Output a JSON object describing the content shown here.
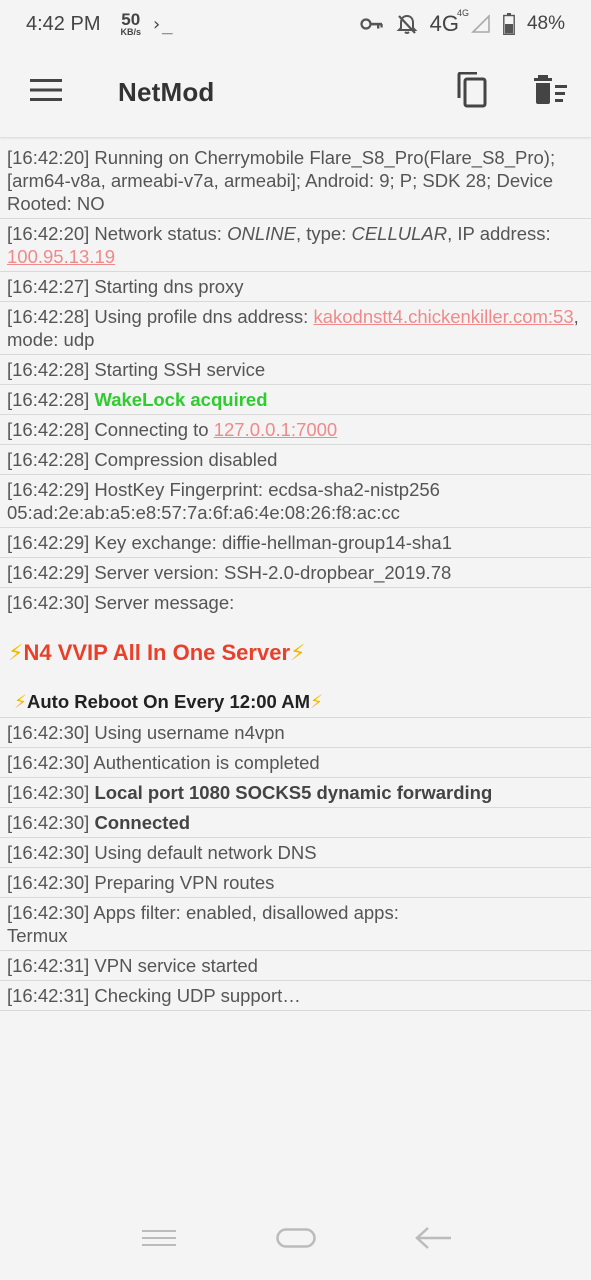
{
  "status_bar": {
    "time": "4:42 PM",
    "net_speed_value": "50",
    "net_speed_unit": "KB/s",
    "terminal_glyph": "›_",
    "network_type": "4G",
    "network_sup": "4G",
    "battery": "48%"
  },
  "app_bar": {
    "title": "NetMod"
  },
  "log": {
    "r1": "[16:42:20] Running on Cherrymobile Flare_S8_Pro(Flare_S8_Pro); [arm64-v8a, armeabi-v7a, armeabi]; Android: 9; P; SDK 28; Device Rooted: NO",
    "r2_prefix": "[16:42:20] Network status: ",
    "r2_status": "ONLINE",
    "r2_mid": ", type: ",
    "r2_type": "CELLULAR",
    "r2_mid2": ", IP address: ",
    "r2_ip": "100.95.13.19",
    "r3": "[16:42:27] Starting dns proxy",
    "r4_prefix": "[16:42:28] Using profile dns address: ",
    "r4_addr": "kakodnstt4.chickenkiller.com:53",
    "r4_suffix": ", mode: udp",
    "r5": "[16:42:28] Starting SSH service",
    "r6_prefix": "[16:42:28] ",
    "r6_green": "WakeLock acquired",
    "r7_prefix": "[16:42:28] Connecting to ",
    "r7_addr": "127.0.0.1:7000",
    "r8": "[16:42:28] Compression disabled",
    "r9": "[16:42:29] HostKey Fingerprint: ecdsa-sha2-nistp256 05:ad:2e:ab:a5:e8:57:7a:6f:a6:4e:08:26:f8:ac:cc",
    "r10": "[16:42:29] Key exchange: diffie-hellman-group14-sha1",
    "r11": "[16:42:29] Server version: SSH-2.0-dropbear_2019.78",
    "r12": "[16:42:30] Server message:",
    "banner_bolt": "⚡",
    "banner_text": "N4 VVIP All In One Server",
    "sub_text": "Auto Reboot On Every 12:00 AM",
    "r13": "[16:42:30] Using username n4vpn",
    "r14": "[16:42:30] Authentication is completed",
    "r15_prefix": "[16:42:30] ",
    "r15_bold": "Local port 1080 SOCKS5 dynamic forwarding",
    "r16_prefix": "[16:42:30] ",
    "r16_bold": "Connected",
    "r17": "[16:42:30] Using default network DNS",
    "r18": "[16:42:30] Preparing VPN routes",
    "r19_line1": "[16:42:30] Apps filter: enabled, disallowed apps:",
    "r19_line2": "Termux",
    "r20": "[16:42:31] VPN service started",
    "r21": "[16:42:31] Checking UDP support…"
  },
  "colors": {
    "link": "#f08a8a",
    "green": "#2ecc2e",
    "banner_red": "#e8402a",
    "bolt": "#f5b800"
  },
  "icons": {
    "menu": "hamburger-menu-icon",
    "copy": "copy-icon",
    "clear": "clear-log-icon",
    "key": "vpn-key-icon",
    "mute": "notifications-off-icon",
    "signal": "signal-icon",
    "battery": "battery-icon"
  }
}
